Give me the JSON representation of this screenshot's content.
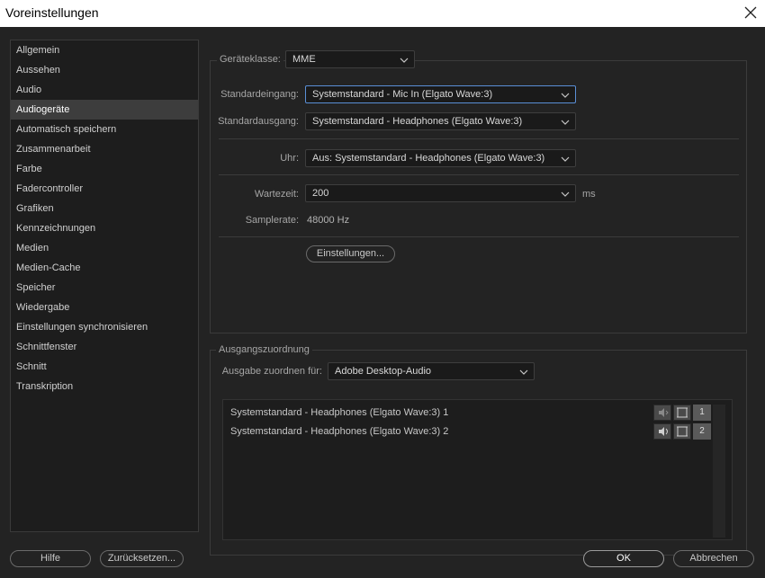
{
  "window": {
    "title": "Voreinstellungen"
  },
  "sidebar": {
    "items": [
      {
        "label": "Allgemein"
      },
      {
        "label": "Aussehen"
      },
      {
        "label": "Audio"
      },
      {
        "label": "Audiogeräte",
        "active": true
      },
      {
        "label": "Automatisch speichern"
      },
      {
        "label": "Zusammenarbeit"
      },
      {
        "label": "Farbe"
      },
      {
        "label": "Fadercontroller"
      },
      {
        "label": "Grafiken"
      },
      {
        "label": "Kennzeichnungen"
      },
      {
        "label": "Medien"
      },
      {
        "label": "Medien-Cache"
      },
      {
        "label": "Speicher"
      },
      {
        "label": "Wiedergabe"
      },
      {
        "label": "Einstellungen synchronisieren"
      },
      {
        "label": "Schnittfenster"
      },
      {
        "label": "Schnitt"
      },
      {
        "label": "Transkription"
      }
    ]
  },
  "device": {
    "class_label": "Geräteklasse:",
    "class_value": "MME",
    "input_label": "Standardeingang:",
    "input_value": "Systemstandard - Mic In (Elgato Wave:3)",
    "output_label": "Standardausgang:",
    "output_value": "Systemstandard - Headphones (Elgato Wave:3)",
    "clock_label": "Uhr:",
    "clock_value": "Aus: Systemstandard - Headphones (Elgato Wave:3)",
    "latency_label": "Wartezeit:",
    "latency_value": "200",
    "latency_unit": "ms",
    "samplerate_label": "Samplerate:",
    "samplerate_value": "48000 Hz",
    "settings_button": "Einstellungen..."
  },
  "output_mapping": {
    "legend": "Ausgangszuordnung",
    "map_for_label": "Ausgabe zuordnen für:",
    "map_for_value": "Adobe Desktop-Audio",
    "channels": [
      {
        "name": "Systemstandard - Headphones (Elgato Wave:3) 1",
        "number": "1"
      },
      {
        "name": "Systemstandard - Headphones (Elgato Wave:3) 2",
        "number": "2"
      }
    ]
  },
  "footer": {
    "help": "Hilfe",
    "reset": "Zurücksetzen...",
    "ok": "OK",
    "cancel": "Abbrechen"
  },
  "icons": {
    "close": "close-icon",
    "chevron": "chevron-down-icon",
    "speaker": "speaker-icon",
    "channel_frame": "channel-frame-icon"
  },
  "colors": {
    "focus": "#5a8fd6",
    "background": "#232323"
  }
}
